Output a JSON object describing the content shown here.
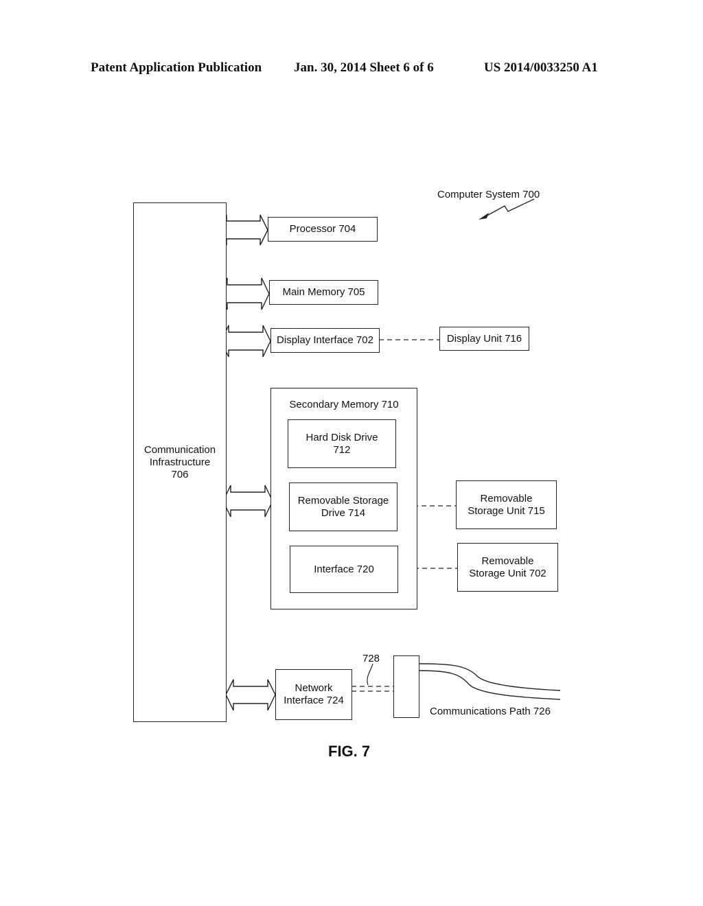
{
  "header": {
    "publication": "Patent Application Publication",
    "date_sheet": "Jan. 30, 2014  Sheet 6 of 6",
    "number": "US 2014/0033250 A1"
  },
  "diagram": {
    "system_label": "Computer System 700",
    "comm_infrastructure": "Communication Infrastructure 706",
    "comm_lines": [
      "Communication",
      "Infrastructure",
      "706"
    ],
    "processor": "Processor 704",
    "main_memory": "Main Memory 705",
    "display_interface": "Display Interface 702",
    "display_unit": "Display Unit 716",
    "secondary_memory": "Secondary Memory 710",
    "hard_disk_lines": [
      "Hard Disk Drive",
      "712"
    ],
    "removable_drive_lines": [
      "Removable Storage",
      "Drive 714"
    ],
    "interface": "Interface 720",
    "removable_unit_715_lines": [
      "Removable",
      "Storage Unit 715"
    ],
    "removable_unit_702_lines": [
      "Removable",
      "Storage Unit 702"
    ],
    "network_interface_lines": [
      "Network",
      "Interface 724"
    ],
    "channel_label": "728",
    "comm_path": "Communications Path 726"
  },
  "figure_title": "FIG. 7"
}
